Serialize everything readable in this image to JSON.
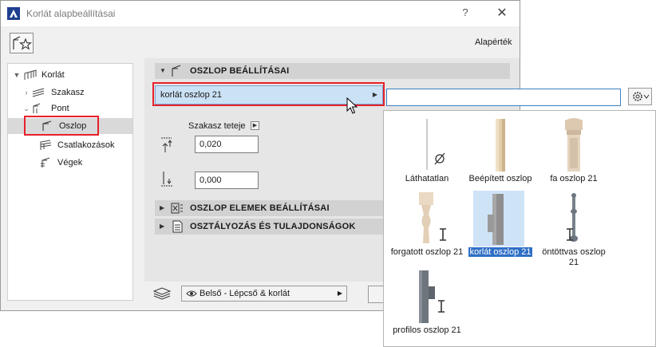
{
  "window": {
    "title": "Korlát alapbeállításai",
    "help": "?",
    "close": "✕"
  },
  "header": {
    "default_label": "Alapérték"
  },
  "tree": {
    "items": [
      {
        "label": "Korlát"
      },
      {
        "label": "Szakasz"
      },
      {
        "label": "Pont"
      },
      {
        "label": "Oszlop"
      },
      {
        "label": "Csatlakozások"
      },
      {
        "label": "Végek"
      }
    ]
  },
  "sections": {
    "post_settings": "OSZLOP BEÁLLÍTÁSAI",
    "post_elements": "OSZLOP ELEMEK BEÁLLÍTÁSAI",
    "classification": "OSZTÁLYOZÁS ÉS TULAJDONSÁGOK"
  },
  "post": {
    "selected": "korlát oszlop 21",
    "segment_top_label": "Szakasz teteje",
    "top_offset": "0,020",
    "bottom_offset": "0,000"
  },
  "layer": {
    "value": "Belső - Lépcső & korlát"
  },
  "search": {
    "value": ""
  },
  "gallery": {
    "items": [
      {
        "label": "Láthatatlan",
        "icon": "invisible-post",
        "selected": false
      },
      {
        "label": "Beépített oszlop",
        "icon": "builtin-post",
        "selected": false
      },
      {
        "label": "fa oszlop 21",
        "icon": "wood-post",
        "selected": false
      },
      {
        "label": "forgatott oszlop 21",
        "icon": "turned-post",
        "selected": false
      },
      {
        "label": "korlát oszlop 21",
        "icon": "railing-post",
        "selected": true
      },
      {
        "label": "öntöttvas oszlop 21",
        "icon": "cast-iron-post",
        "selected": false
      },
      {
        "label": "profilos oszlop 21",
        "icon": "profile-post",
        "selected": false
      }
    ]
  },
  "colors": {
    "highlight_red": "#e8202a",
    "selection_blue": "#2f6fc5",
    "field_blue": "#cbe1f5"
  }
}
